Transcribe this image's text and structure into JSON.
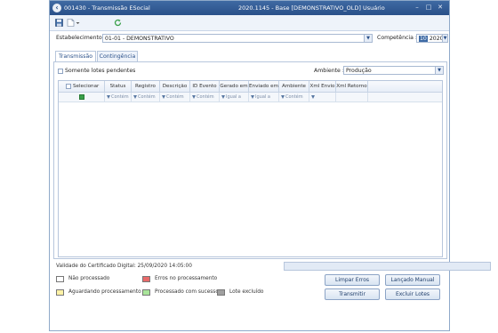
{
  "titlebar": {
    "left_title": "001430 - Transmissão ESocial",
    "center_title": "2020.1145 - Base [DEMONSTRATIVO_OLD] Usuário",
    "minimize": "–",
    "maximize": "□",
    "close": "✕"
  },
  "toolbar": {
    "save_icon": "save-icon",
    "new_icon": "document-icon",
    "refresh_icon": "refresh-icon"
  },
  "filters": {
    "estab_label": "Estabelecimento :",
    "estab_value": "01-01 - DEMONSTRATIVO",
    "comp_label": "Competência :",
    "comp_month": "10",
    "comp_year": "2020"
  },
  "tabs": [
    {
      "label": "Transmissão",
      "active": true
    },
    {
      "label": "Contingência",
      "active": false
    }
  ],
  "panel": {
    "pending_label": "Somente lotes pendentes",
    "ambiente_label": "Ambiente :",
    "ambiente_value": "Produção"
  },
  "grid": {
    "columns": [
      "Selecionar",
      "Status",
      "Registro",
      "Descrição",
      "ID Evento",
      "Gerado em",
      "Enviado em",
      "Ambiente",
      "Xml Envio",
      "Xml Retorno"
    ],
    "filter_cells": [
      "",
      "Contém",
      "Contém",
      "Contém",
      "Contém",
      "Igual a",
      "Igual a",
      "Contém",
      "",
      ""
    ]
  },
  "footer": {
    "certificate": "Validade do Certificado Digital: 25/09/2020 14:05:00"
  },
  "legend": [
    {
      "label": "Não processado",
      "color": "#ffffff"
    },
    {
      "label": "Erros no processamento",
      "color": "#e96a6a"
    },
    {
      "label": "Aguardando processamento",
      "color": "#fff2a6"
    },
    {
      "label": "Processado com sucesso",
      "color": "#a9e59a"
    },
    {
      "label": "Lote excluído",
      "color": "#a0a0a0"
    }
  ],
  "buttons": {
    "clear": "Limpar Erros",
    "manual": "Lançado Manual",
    "transmit": "Transmitir",
    "delete": "Excluir Lotes"
  }
}
